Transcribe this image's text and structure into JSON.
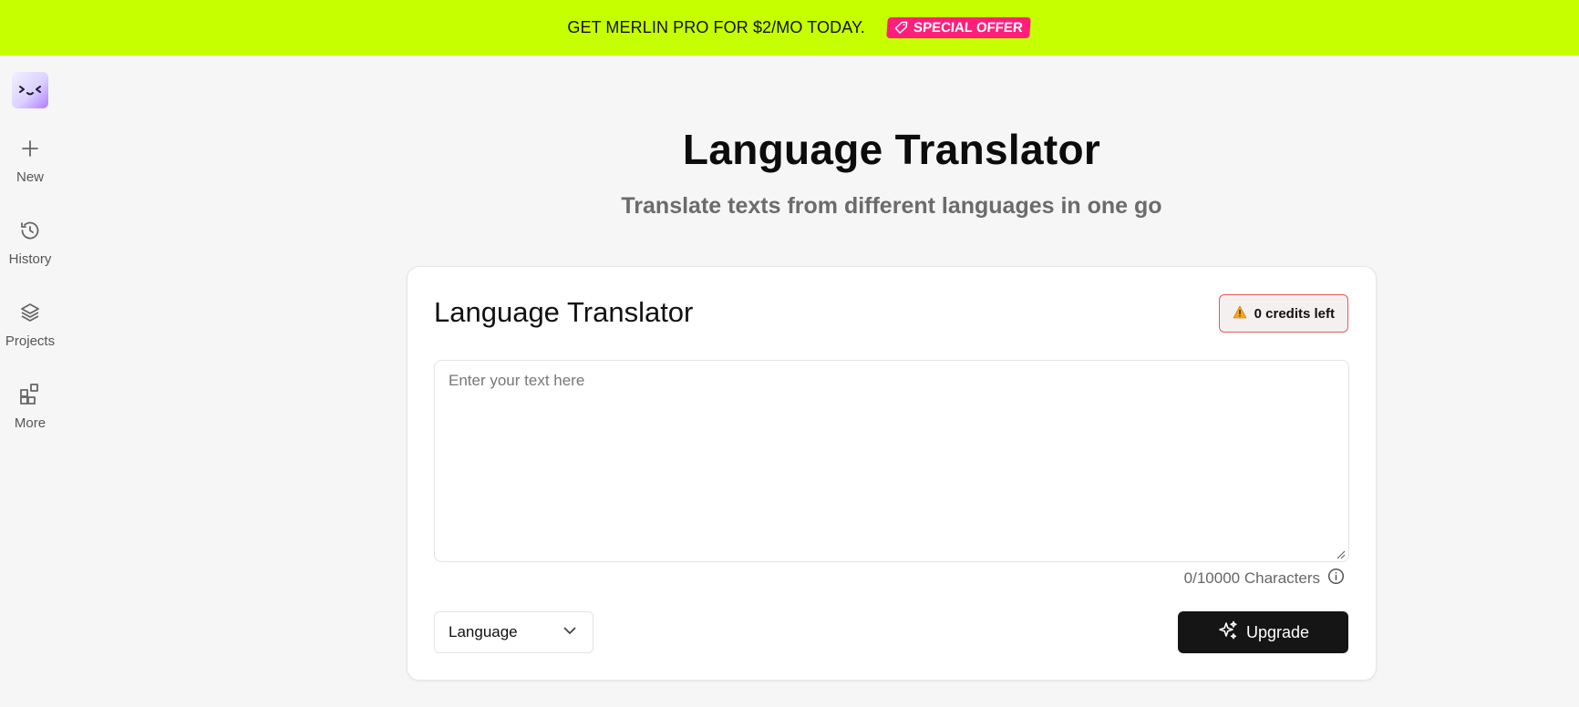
{
  "promo": {
    "text": "GET MERLIN PRO FOR $2/MO TODAY.",
    "badge": "SPECIAL OFFER",
    "background": "#c6ff00",
    "badge_color": "#ff1f7a"
  },
  "sidebar": {
    "logo_icon": "merlin-face-logo",
    "items": [
      {
        "label": "New",
        "icon": "plus-icon"
      },
      {
        "label": "History",
        "icon": "history-icon"
      },
      {
        "label": "Projects",
        "icon": "layers-icon"
      },
      {
        "label": "More",
        "icon": "apps-icon"
      }
    ]
  },
  "header": {
    "title": "Language Translator",
    "subtitle": "Translate texts from different languages in one go"
  },
  "card": {
    "title": "Language Translator",
    "credits": "0 credits left",
    "input": {
      "placeholder": "Enter your text here",
      "value": ""
    },
    "char_count": "0/10000 Characters",
    "language_select": "Language",
    "upgrade_label": "Upgrade"
  }
}
